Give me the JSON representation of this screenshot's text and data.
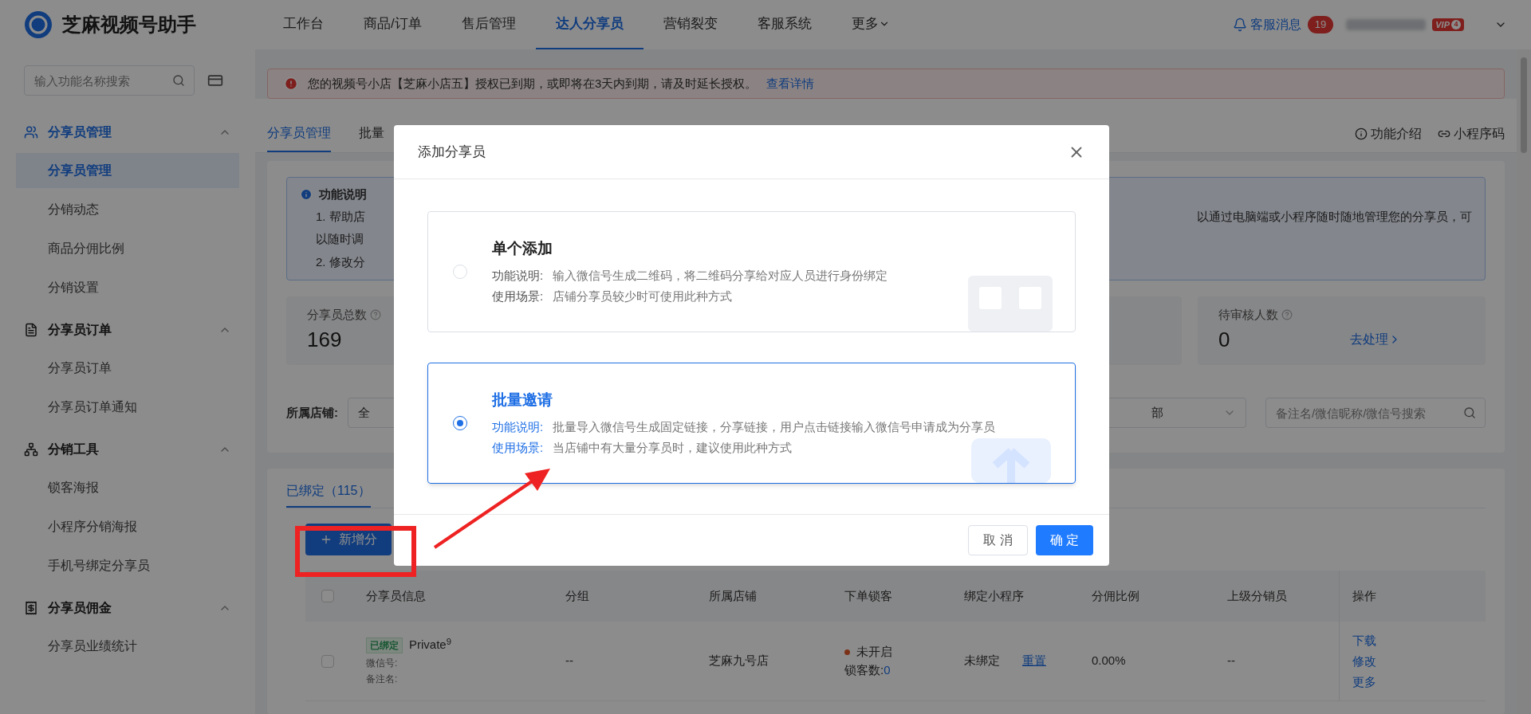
{
  "header": {
    "logo": "芝麻视频号助手",
    "nav": [
      {
        "label": "工作台",
        "selected": false
      },
      {
        "label": "商品/订单",
        "selected": false
      },
      {
        "label": "售后管理",
        "selected": false
      },
      {
        "label": "达人分享员",
        "selected": true
      },
      {
        "label": "营销裂变",
        "selected": false
      },
      {
        "label": "客服系统",
        "selected": false
      },
      {
        "label": "更多",
        "selected": false,
        "dropdown": true
      }
    ],
    "service": {
      "label": "客服消息",
      "count": "19"
    },
    "vip": {
      "label": "VIP",
      "level": "4"
    }
  },
  "sidebar": {
    "search": {
      "placeholder": "输入功能名称搜索"
    },
    "groups": [
      {
        "title": "分享员管理",
        "expanded": true,
        "selected": true,
        "items": [
          {
            "label": "分享员管理",
            "selected": true
          },
          {
            "label": "分销动态",
            "selected": false
          },
          {
            "label": "商品分佣比例",
            "selected": false
          },
          {
            "label": "分销设置",
            "selected": false
          }
        ]
      },
      {
        "title": "分享员订单",
        "expanded": true,
        "selected": false,
        "items": [
          {
            "label": "分享员订单",
            "selected": false
          },
          {
            "label": "分享员订单通知",
            "selected": false
          }
        ]
      },
      {
        "title": "分销工具",
        "expanded": true,
        "selected": false,
        "items": [
          {
            "label": "锁客海报",
            "selected": false
          },
          {
            "label": "小程序分销海报",
            "selected": false
          },
          {
            "label": "手机号绑定分享员",
            "selected": false
          }
        ]
      },
      {
        "title": "分享员佣金",
        "expanded": true,
        "selected": false,
        "items": [
          {
            "label": "分享员业绩统计",
            "selected": false
          }
        ]
      }
    ]
  },
  "alert": {
    "text": "您的视频号小店【芝麻小店五】授权已到期，或即将在3天内到期，请及时延长授权。",
    "link": "查看详情"
  },
  "tabs": [
    {
      "label": "分享员管理",
      "selected": true
    },
    {
      "label": "批量",
      "selected": false
    }
  ],
  "tab_actions": [
    "功能介绍",
    "小程序码"
  ],
  "info": {
    "title": "功能说明",
    "lines": [
      {
        "left": "1. 帮助店",
        "right": "以通过电脑端或小程序随时随地管理您的分享员，可"
      },
      {
        "left": "以随时调"
      },
      {
        "left": "2. 修改分"
      }
    ]
  },
  "stats": {
    "first": {
      "label": "分享员总数",
      "value": "169"
    },
    "last": {
      "label": "待审核人数",
      "value": "0",
      "action": "去处理"
    }
  },
  "filters": {
    "store_label": "所属店铺:",
    "store_value": "全",
    "second_value": "部",
    "search_placeholder": "备注名/微信昵称/微信号搜索"
  },
  "list": {
    "tab": "已绑定（115）",
    "add_button": "新增分",
    "select_all_checked": false,
    "columns": [
      "分享员信息",
      "分组",
      "所属店铺",
      "下单锁客",
      "绑定小程序",
      "分佣比例",
      "上级分销员",
      "操作"
    ],
    "rows": [
      {
        "checked": false,
        "tag": "已绑定",
        "name": "Private$^{9}$",
        "wechat": "微信号:",
        "remark": "备注名:",
        "group": "--",
        "store": "芝麻九号店",
        "lock_status": "未开启",
        "lock_on": false,
        "lock_count_label": "锁客数:",
        "lock_count": "0",
        "mini": "未绑定",
        "mini_action": "重置",
        "ratio": "0.00%",
        "parent": "--",
        "actions": [
          "下载",
          "修改",
          "更多"
        ]
      }
    ]
  },
  "dialog": {
    "title": "添加分享员",
    "options": [
      {
        "kind": "qr",
        "title": "单个添加",
        "selected": false,
        "lines": [
          {
            "label": "功能说明:",
            "text": "输入微信号生成二维码，将二维码分享给对应人员进行身份绑定"
          },
          {
            "label": "使用场景:",
            "text": "店铺分享员较少时可使用此种方式"
          }
        ]
      },
      {
        "kind": "upload",
        "title": "批量邀请",
        "selected": true,
        "lines": [
          {
            "label": "功能说明:",
            "text": "批量导入微信号生成固定链接，分享链接，用户点击链接输入微信号申请成为分享员"
          },
          {
            "label": "使用场景:",
            "text": "当店铺中有大量分享员时，建议使用此种方式"
          }
        ]
      }
    ],
    "buttons": [
      {
        "label": "取 消",
        "primary": false
      },
      {
        "label": "确 定",
        "primary": true
      }
    ]
  }
}
